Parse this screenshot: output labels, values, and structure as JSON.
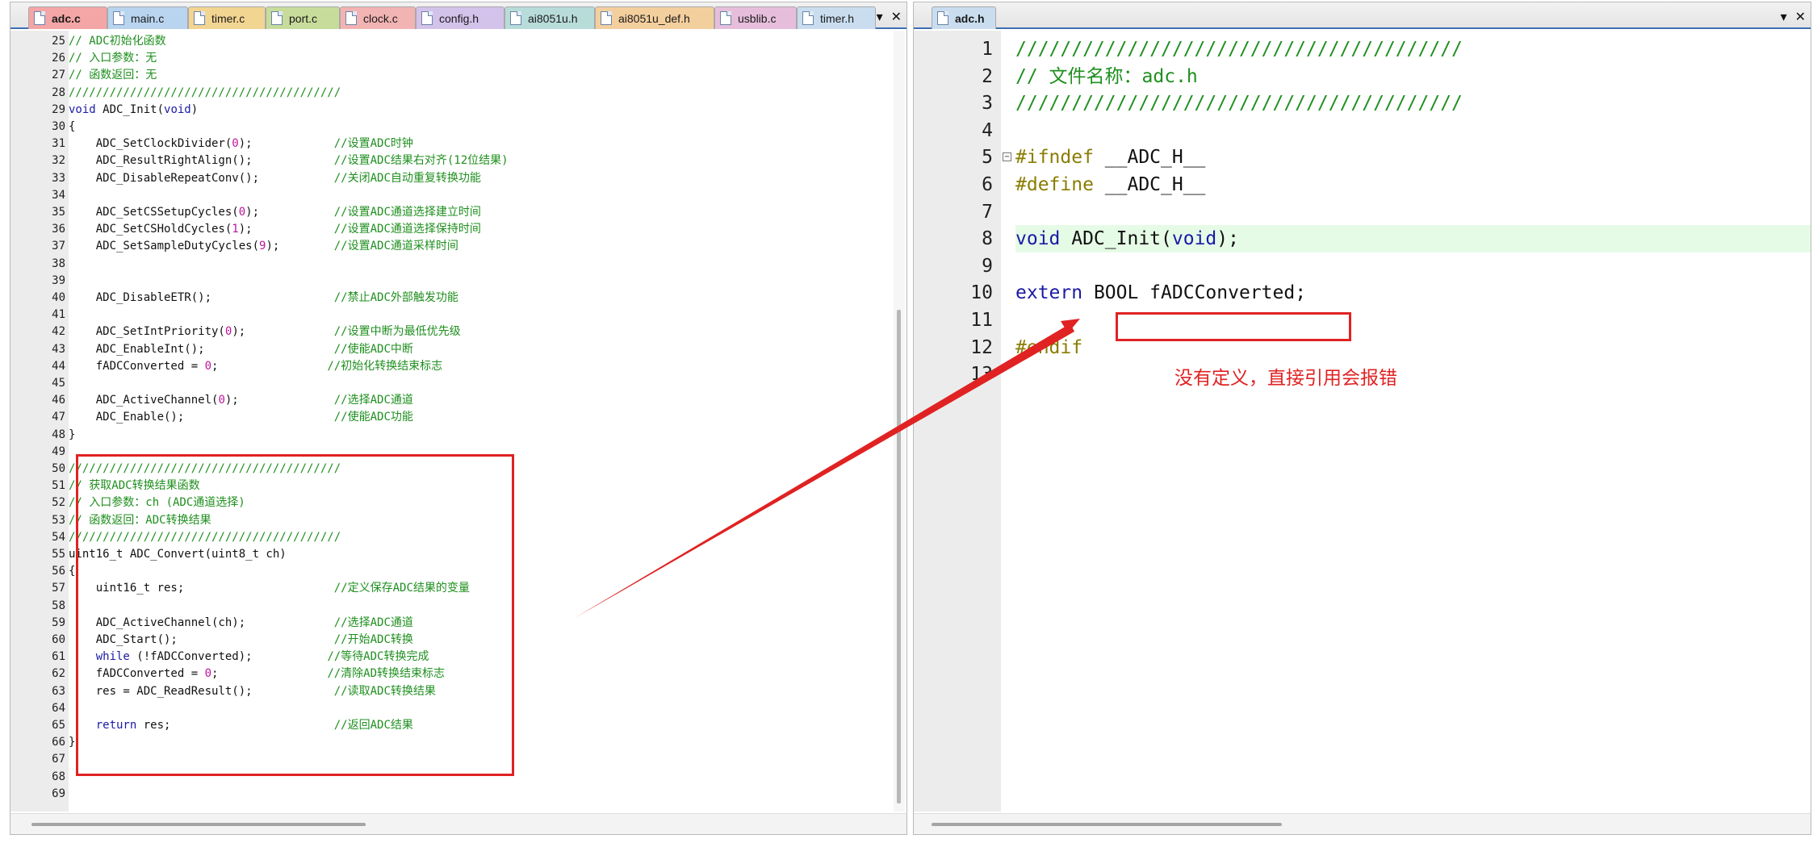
{
  "left_pane": {
    "tabs": [
      {
        "label": "adc.c",
        "color": "#f4a6a6",
        "active": true
      },
      {
        "label": "main.c",
        "color": "#b9d4ef"
      },
      {
        "label": "timer.c",
        "color": "#f3d592"
      },
      {
        "label": "port.c",
        "color": "#c7dc9b"
      },
      {
        "label": "clock.c",
        "color": "#f2b3b3"
      },
      {
        "label": "config.h",
        "color": "#d3c2ea"
      },
      {
        "label": "ai8051u.h",
        "color": "#b8dcd9"
      },
      {
        "label": "ai8051u_def.h",
        "color": "#f4cf9e"
      },
      {
        "label": "usblib.c",
        "color": "#e6bedb"
      },
      {
        "label": "timer.h",
        "color": "#c9ddef"
      }
    ],
    "tab_menu_glyph": "▾",
    "close_glyph": "✕",
    "lines": [
      {
        "n": "25",
        "segs": [
          [
            "c",
            "// ADC初始化函数"
          ]
        ]
      },
      {
        "n": "26",
        "segs": [
          [
            "c",
            "// 入口参数：无"
          ]
        ]
      },
      {
        "n": "27",
        "segs": [
          [
            "c",
            "// 函数返回：无"
          ]
        ]
      },
      {
        "n": "28",
        "segs": [
          [
            "c",
            "////////////////////////////////////////"
          ]
        ]
      },
      {
        "n": "29",
        "segs": [
          [
            "k",
            "void"
          ],
          [
            "t",
            " ADC_Init("
          ],
          [
            "k",
            "void"
          ],
          [
            "t",
            ")"
          ]
        ]
      },
      {
        "n": "30",
        "segs": [
          [
            "t",
            "{"
          ]
        ],
        "fold": true
      },
      {
        "n": "31",
        "segs": [
          [
            "t",
            "    ADC_SetClockDivider("
          ],
          [
            "n",
            "0"
          ],
          [
            "t",
            ");            "
          ],
          [
            "c",
            "//设置ADC时钟"
          ]
        ]
      },
      {
        "n": "32",
        "segs": [
          [
            "t",
            "    ADC_ResultRightAlign();            "
          ],
          [
            "c",
            "//设置ADC结果右对齐(12位结果)"
          ]
        ]
      },
      {
        "n": "33",
        "segs": [
          [
            "t",
            "    ADC_DisableRepeatConv();           "
          ],
          [
            "c",
            "//关闭ADC自动重复转换功能"
          ]
        ]
      },
      {
        "n": "34",
        "segs": []
      },
      {
        "n": "35",
        "segs": [
          [
            "t",
            "    ADC_SetCSSetupCycles("
          ],
          [
            "n",
            "0"
          ],
          [
            "t",
            ");           "
          ],
          [
            "c",
            "//设置ADC通道选择建立时间"
          ]
        ]
      },
      {
        "n": "36",
        "segs": [
          [
            "t",
            "    ADC_SetCSHoldCycles("
          ],
          [
            "n",
            "1"
          ],
          [
            "t",
            ");            "
          ],
          [
            "c",
            "//设置ADC通道选择保持时间"
          ]
        ]
      },
      {
        "n": "37",
        "segs": [
          [
            "t",
            "    ADC_SetSampleDutyCycles("
          ],
          [
            "n",
            "9"
          ],
          [
            "t",
            ");        "
          ],
          [
            "c",
            "//设置ADC通道采样时间"
          ]
        ]
      },
      {
        "n": "38",
        "segs": []
      },
      {
        "n": "39",
        "segs": []
      },
      {
        "n": "40",
        "segs": [
          [
            "t",
            "    ADC_DisableETR();                  "
          ],
          [
            "c",
            "//禁止ADC外部触发功能"
          ]
        ]
      },
      {
        "n": "41",
        "segs": []
      },
      {
        "n": "42",
        "segs": [
          [
            "t",
            "    ADC_SetIntPriority("
          ],
          [
            "n",
            "0"
          ],
          [
            "t",
            ");             "
          ],
          [
            "c",
            "//设置中断为最低优先级"
          ]
        ]
      },
      {
        "n": "43",
        "segs": [
          [
            "t",
            "    ADC_EnableInt();                   "
          ],
          [
            "c",
            "//使能ADC中断"
          ]
        ]
      },
      {
        "n": "44",
        "segs": [
          [
            "t",
            "    fADCConverted = "
          ],
          [
            "n",
            "0"
          ],
          [
            "t",
            ";                "
          ],
          [
            "c",
            "//初始化转换结束标志"
          ]
        ]
      },
      {
        "n": "45",
        "segs": []
      },
      {
        "n": "46",
        "segs": [
          [
            "t",
            "    ADC_ActiveChannel("
          ],
          [
            "n",
            "0"
          ],
          [
            "t",
            ");              "
          ],
          [
            "c",
            "//选择ADC通道"
          ]
        ]
      },
      {
        "n": "47",
        "segs": [
          [
            "t",
            "    ADC_Enable();                      "
          ],
          [
            "c",
            "//使能ADC功能"
          ]
        ]
      },
      {
        "n": "48",
        "segs": [
          [
            "t",
            "}"
          ]
        ],
        "fold_end": true
      },
      {
        "n": "49",
        "segs": []
      },
      {
        "n": "50",
        "segs": [
          [
            "c",
            "////////////////////////////////////////"
          ]
        ]
      },
      {
        "n": "51",
        "segs": [
          [
            "c",
            "// 获取ADC转换结果函数"
          ]
        ]
      },
      {
        "n": "52",
        "segs": [
          [
            "c",
            "// 入口参数：ch (ADC通道选择)"
          ]
        ]
      },
      {
        "n": "53",
        "segs": [
          [
            "c",
            "// 函数返回：ADC转换结果"
          ]
        ]
      },
      {
        "n": "54",
        "segs": [
          [
            "c",
            "////////////////////////////////////////"
          ]
        ]
      },
      {
        "n": "55",
        "segs": [
          [
            "t",
            "uint16_t ADC_Convert(uint8_t ch)"
          ]
        ]
      },
      {
        "n": "56",
        "segs": [
          [
            "t",
            "{"
          ]
        ],
        "fold": true
      },
      {
        "n": "57",
        "segs": [
          [
            "t",
            "    uint16_t res;                      "
          ],
          [
            "c",
            "//定义保存ADC结果的变量"
          ]
        ]
      },
      {
        "n": "58",
        "segs": []
      },
      {
        "n": "59",
        "segs": [
          [
            "t",
            "    ADC_ActiveChannel(ch);             "
          ],
          [
            "c",
            "//选择ADC通道"
          ]
        ]
      },
      {
        "n": "60",
        "segs": [
          [
            "t",
            "    ADC_Start();                       "
          ],
          [
            "c",
            "//开始ADC转换"
          ]
        ]
      },
      {
        "n": "61",
        "segs": [
          [
            "t",
            "    "
          ],
          [
            "k",
            "while"
          ],
          [
            "t",
            " (!fADCConverted);           "
          ],
          [
            "c",
            "//等待ADC转换完成"
          ]
        ]
      },
      {
        "n": "62",
        "segs": [
          [
            "t",
            "    fADCConverted = "
          ],
          [
            "n",
            "0"
          ],
          [
            "t",
            ";                "
          ],
          [
            "c",
            "//清除AD转换结束标志"
          ]
        ]
      },
      {
        "n": "63",
        "segs": [
          [
            "t",
            "    res = ADC_ReadResult();            "
          ],
          [
            "c",
            "//读取ADC转换结果"
          ]
        ]
      },
      {
        "n": "64",
        "segs": []
      },
      {
        "n": "65",
        "segs": [
          [
            "t",
            "    "
          ],
          [
            "k",
            "return"
          ],
          [
            "t",
            " res;                        "
          ],
          [
            "c",
            "//返回ADC结果"
          ]
        ]
      },
      {
        "n": "66",
        "segs": [
          [
            "t",
            "}"
          ]
        ]
      },
      {
        "n": "67",
        "segs": []
      },
      {
        "n": "68",
        "segs": []
      },
      {
        "n": "69",
        "segs": []
      }
    ]
  },
  "right_pane": {
    "tabs": [
      {
        "label": "adc.h",
        "color": "#c9ddef",
        "active": true
      }
    ],
    "tab_menu_glyph": "▾",
    "close_glyph": "✕",
    "lines": [
      {
        "n": "1",
        "segs": [
          [
            "c",
            "////////////////////////////////////////"
          ]
        ]
      },
      {
        "n": "2",
        "segs": [
          [
            "c",
            "// 文件名称：adc.h"
          ]
        ]
      },
      {
        "n": "3",
        "segs": [
          [
            "c",
            "////////////////////////////////////////"
          ]
        ]
      },
      {
        "n": "4",
        "segs": []
      },
      {
        "n": "5",
        "segs": [
          [
            "p",
            "#ifndef"
          ],
          [
            "t",
            " __ADC_H__"
          ]
        ],
        "fold": true
      },
      {
        "n": "6",
        "segs": [
          [
            "p",
            "#define"
          ],
          [
            "t",
            " __ADC_H__"
          ]
        ]
      },
      {
        "n": "7",
        "segs": []
      },
      {
        "n": "8",
        "segs": [
          [
            "k",
            "void"
          ],
          [
            "t",
            " ADC_Init("
          ],
          [
            "k",
            "void"
          ],
          [
            "t",
            ");"
          ]
        ],
        "highlight": true
      },
      {
        "n": "9",
        "segs": []
      },
      {
        "n": "10",
        "segs": [
          [
            "k",
            "extern"
          ],
          [
            "t",
            " BOOL fADCConverted;"
          ]
        ]
      },
      {
        "n": "11",
        "segs": []
      },
      {
        "n": "12",
        "segs": [
          [
            "p",
            "#endif"
          ]
        ]
      },
      {
        "n": "13",
        "segs": []
      }
    ]
  },
  "annotation": {
    "text": "没有定义，直接引用会报错",
    "color": "#e02222"
  }
}
